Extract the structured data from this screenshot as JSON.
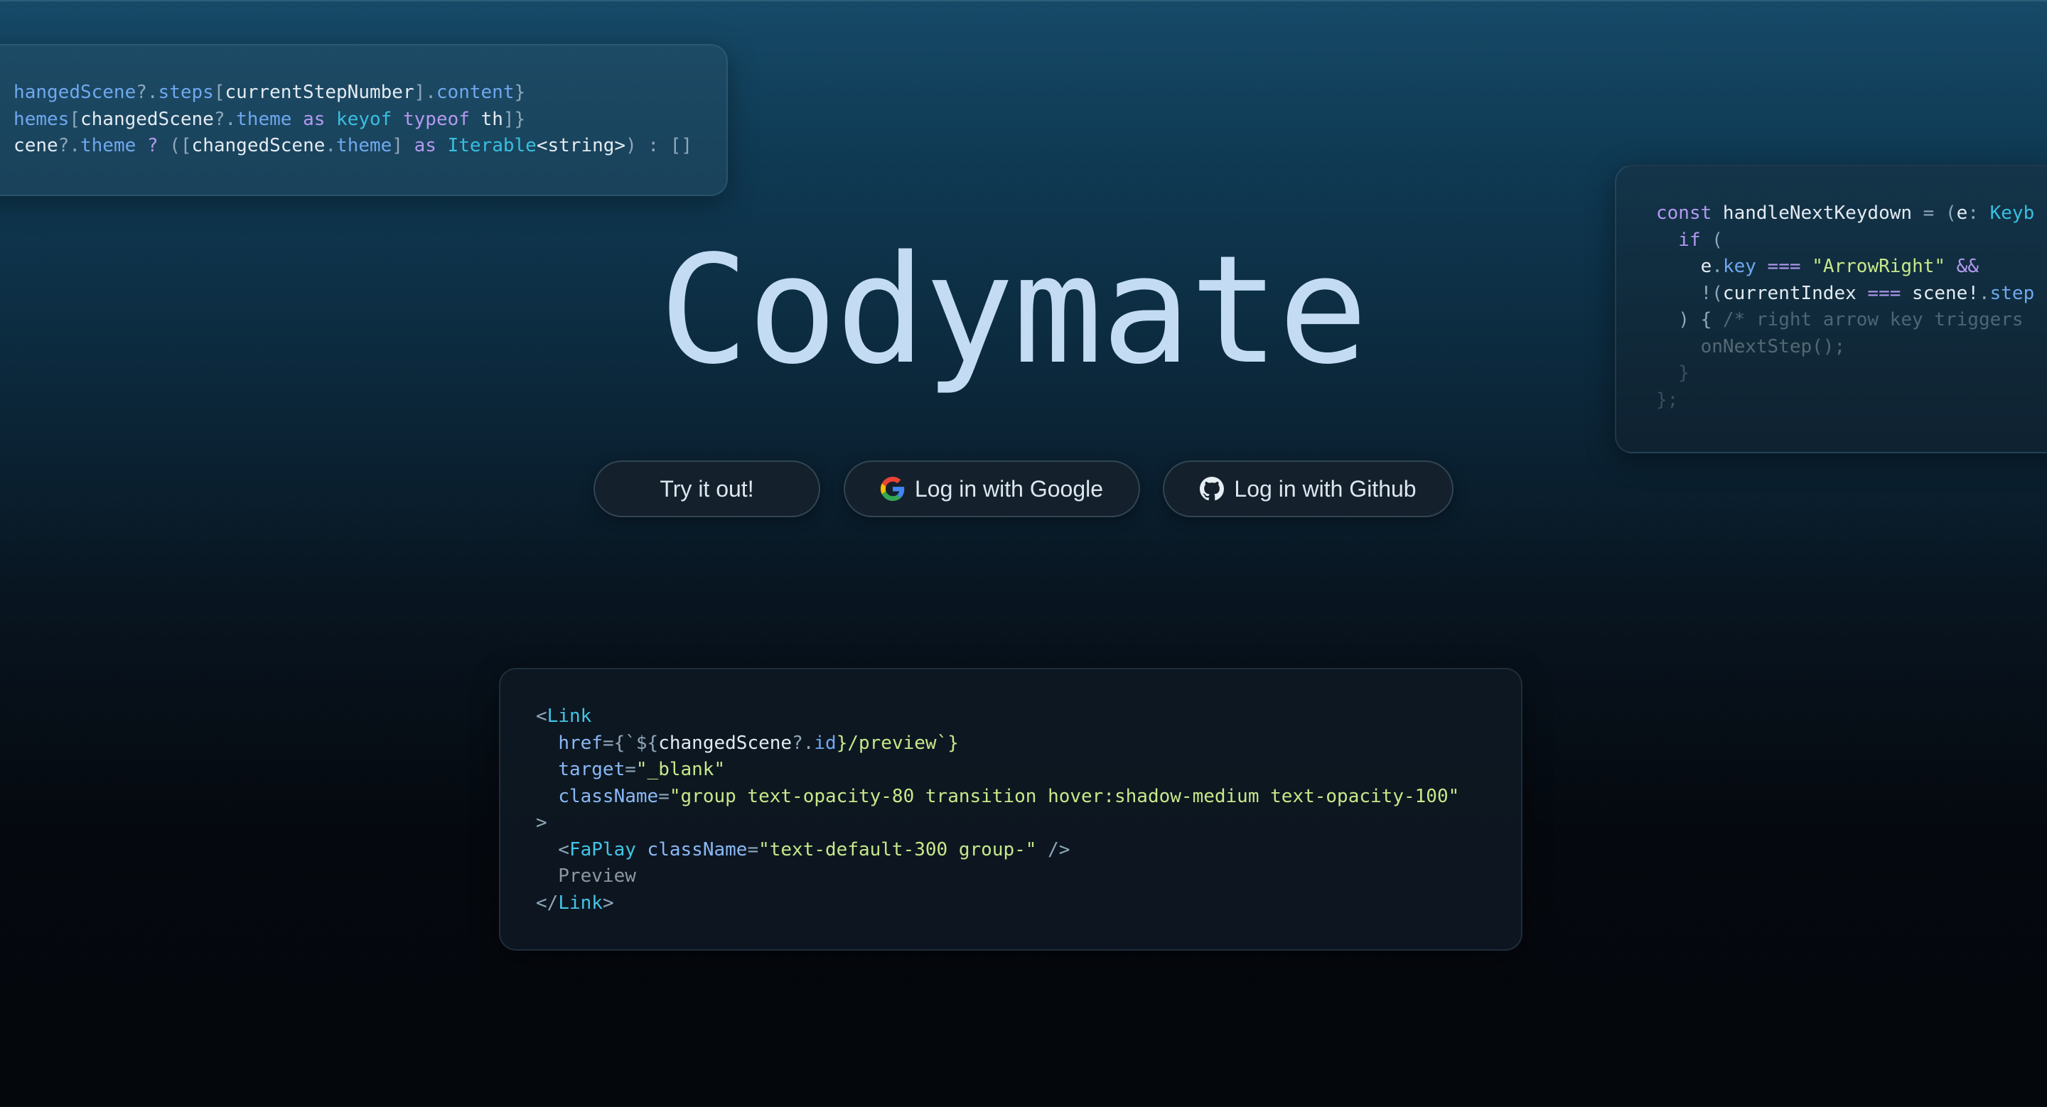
{
  "app_title": "Codymate",
  "buttons": {
    "try_label": "Try it out!",
    "google_label": "Log in with Google",
    "github_label": "Log in with Github"
  },
  "icons": {
    "google": "google-icon",
    "github": "github-icon"
  },
  "colors": {
    "title": "#c3dcf3",
    "background_top": "#164a68",
    "background_bottom": "#04070c"
  },
  "code_cards": {
    "top_left": {
      "line1": {
        "a": "hangedScene",
        "b": "?.",
        "c": "steps",
        "d": "[",
        "e": "currentStepNumber",
        "f": "].",
        "g": "content",
        "h": "}"
      },
      "line2": {
        "a": "hemes",
        "b": "[",
        "c": "changedScene",
        "d": "?.",
        "e": "theme",
        "f": " as ",
        "g": "keyof",
        "h": " typeof ",
        "i": "th",
        "j": "]}"
      },
      "line3": {
        "a": "cene",
        "b": "?.",
        "c": "theme",
        "d": " ? ",
        "e": "([",
        "f": "changedScene",
        "g": ".",
        "h": "theme",
        "i": "] ",
        "j": "as ",
        "k": "Iterable",
        "l": "<string>",
        "m": ") : []"
      }
    },
    "top_right": {
      "line1": {
        "a": "const ",
        "b": "handleNextKeydown",
        "c": " = (",
        "d": "e",
        "e": ": ",
        "f": "Keyb"
      },
      "line2": {
        "a": "  if",
        "b": " ("
      },
      "line3": {
        "a": "    e",
        "b": ".",
        "c": "key",
        "d": " === ",
        "e": "\"ArrowRight\"",
        "f": " &&"
      },
      "line4": {
        "a": "    !(",
        "b": "currentIndex",
        "c": " === ",
        "d": "scene!",
        "e": ".",
        "f": "step"
      },
      "line5": {
        "a": "  ) { ",
        "b": "/* right arrow key triggers"
      },
      "line6": {
        "a": "    onNextStep();"
      },
      "line7": {
        "a": "  }"
      },
      "line8": {
        "a": "};"
      }
    },
    "middle": {
      "line1": {
        "a": "<",
        "b": "Link"
      },
      "line2": {
        "a": "  ",
        "b": "href",
        "c": "={`${",
        "d": "changedScene",
        "e": "?.",
        "f": "id",
        "g": "}/preview`}"
      },
      "line3": {
        "a": "  ",
        "b": "target",
        "c": "=",
        "d": "\"_blank\""
      },
      "line4": {
        "a": "  ",
        "b": "className",
        "c": "=",
        "d": "\"group text-opacity-80 transition hover:shadow-medium text-opacity-100\""
      },
      "line5": {
        "a": ">"
      },
      "line6": {
        "a": "  <",
        "b": "FaPlay",
        "c": " ",
        "d": "className",
        "e": "=",
        "f": "\"text-default-300 group-\"",
        "g": " />"
      },
      "line7": {
        "a": "  Preview"
      },
      "line8": {
        "a": "</",
        "b": "Link",
        "c": ">"
      }
    }
  }
}
